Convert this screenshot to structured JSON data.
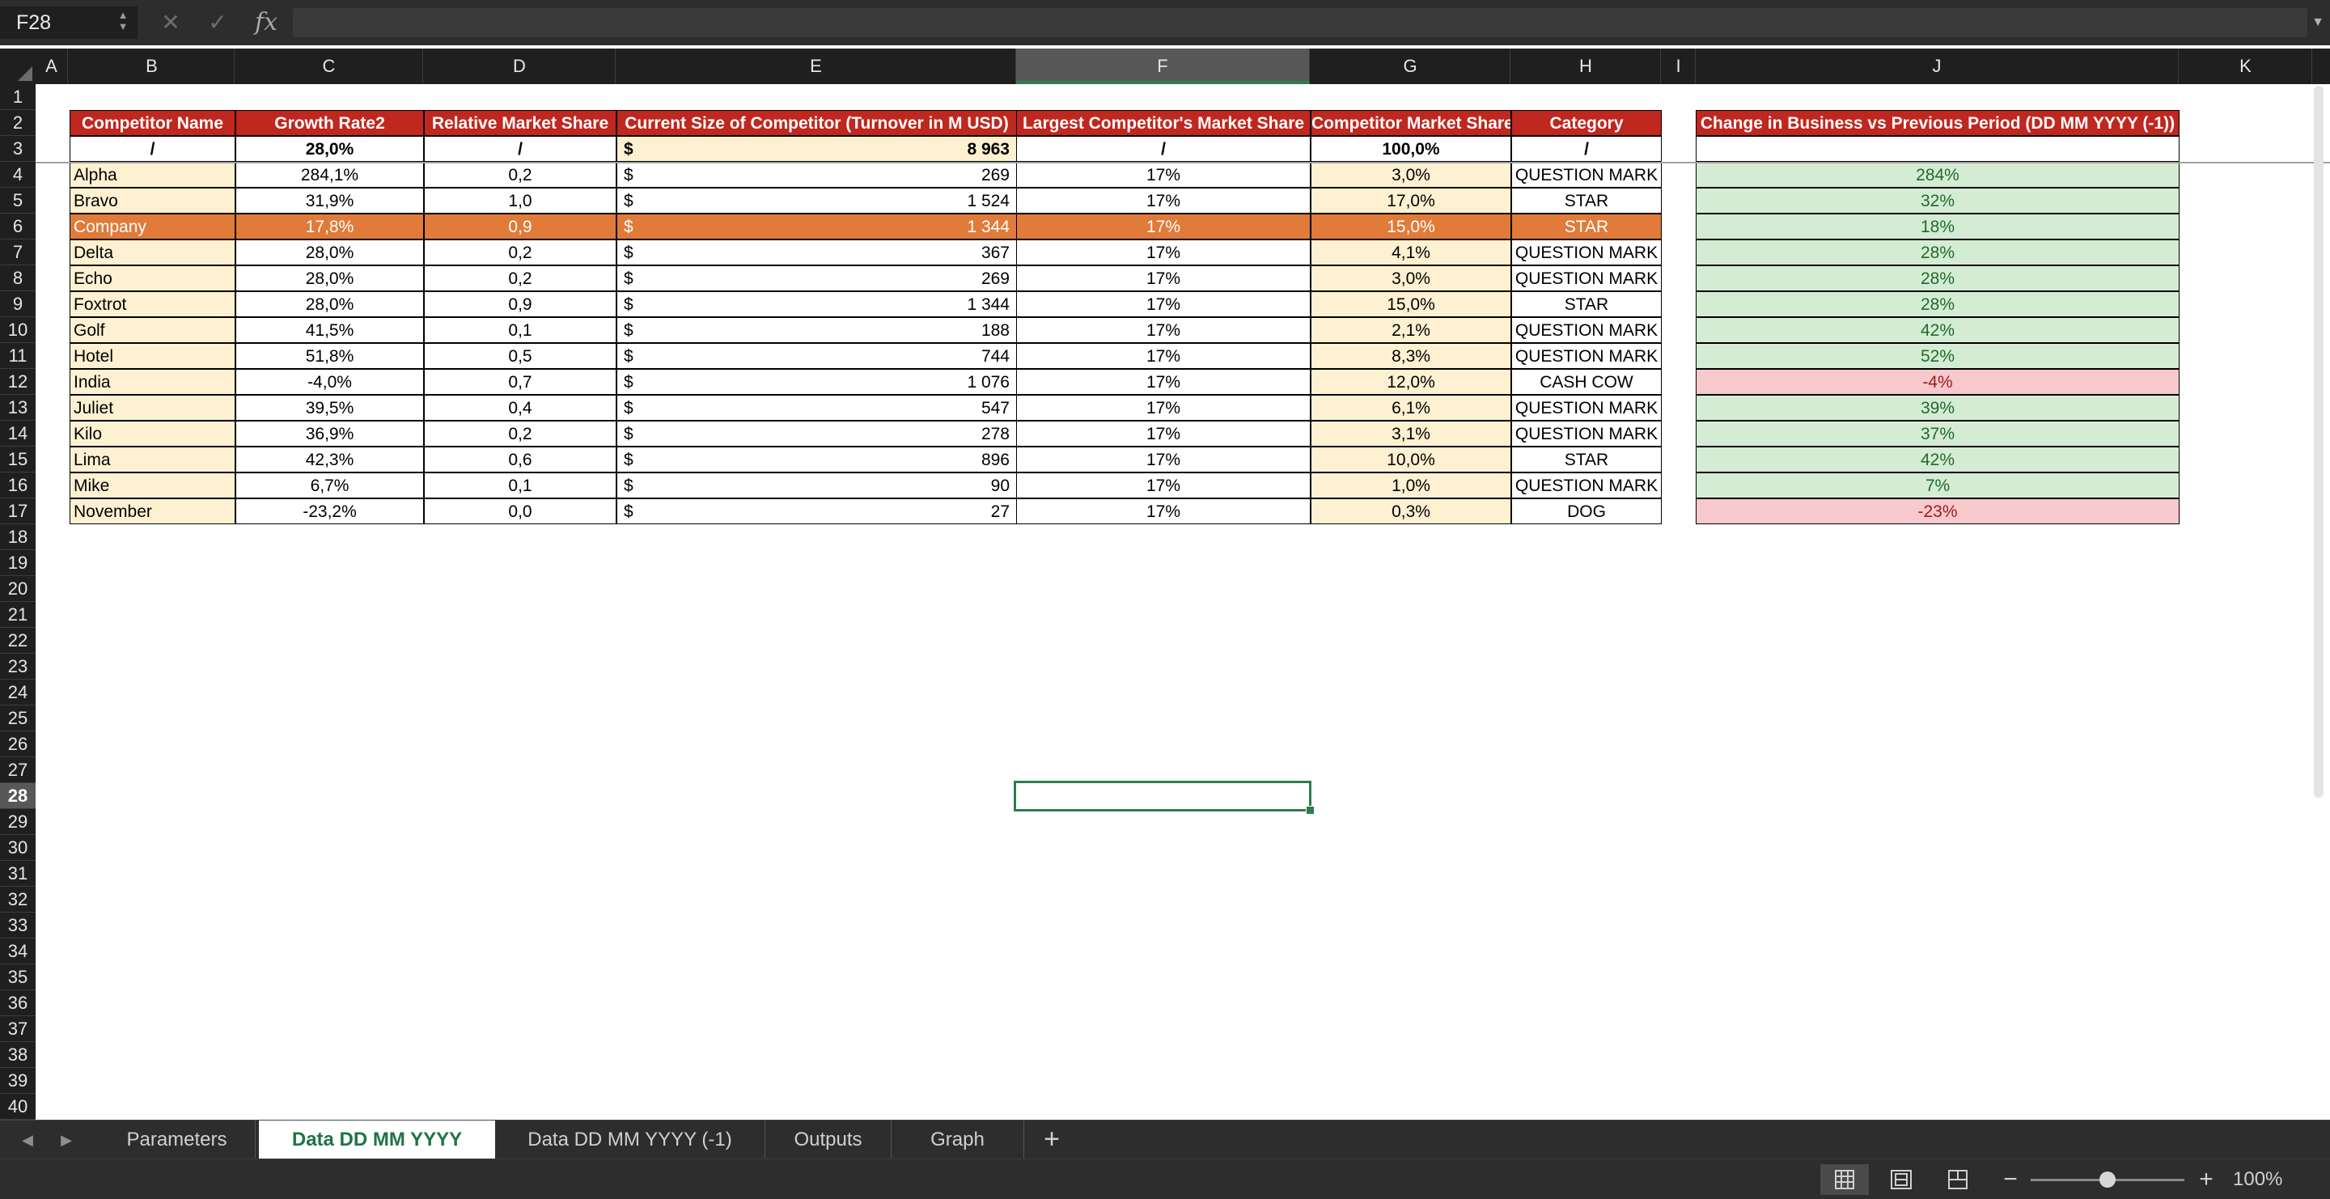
{
  "formula_bar": {
    "name_box": "F28",
    "fx": "fx",
    "formula": ""
  },
  "columns": [
    "A",
    "B",
    "C",
    "D",
    "E",
    "F",
    "G",
    "H",
    "I",
    "J",
    "K"
  ],
  "rows": [
    "1",
    "2",
    "3",
    "4",
    "5",
    "6",
    "7",
    "8",
    "9",
    "10",
    "11",
    "12",
    "13",
    "14",
    "15",
    "16",
    "17",
    "18",
    "19",
    "20",
    "21",
    "22",
    "23",
    "24",
    "25",
    "26",
    "27",
    "28",
    "29",
    "30",
    "31",
    "32",
    "33",
    "34",
    "35",
    "36",
    "37",
    "38",
    "39",
    "40"
  ],
  "selected": {
    "column": "F",
    "row": "28"
  },
  "table": {
    "headers": {
      "name": "Competitor Name",
      "growth": "Growth Rate2",
      "rms": "Relative Market Share",
      "size": "Current Size of Competitor (Turnover in M USD)",
      "largest": "Largest Competitor's Market Share",
      "share": "Competitor Market Share",
      "category": "Category"
    },
    "totals": {
      "name": "/",
      "growth": "28,0%",
      "rms": "/",
      "currency": "$",
      "size": "8 963",
      "largest": "/",
      "share": "100,0%",
      "category": "/"
    },
    "rows": [
      {
        "name": "Alpha",
        "growth": "284,1%",
        "rms": "0,2",
        "currency": "$",
        "size": "269",
        "largest": "17%",
        "share": "3,0%",
        "category": "QUESTION MARK"
      },
      {
        "name": "Bravo",
        "growth": "31,9%",
        "rms": "1,0",
        "currency": "$",
        "size": "1 524",
        "largest": "17%",
        "share": "17,0%",
        "category": "STAR"
      },
      {
        "name": "Company",
        "growth": "17,8%",
        "rms": "0,9",
        "currency": "$",
        "size": "1 344",
        "largest": "17%",
        "share": "15,0%",
        "category": "STAR"
      },
      {
        "name": "Delta",
        "growth": "28,0%",
        "rms": "0,2",
        "currency": "$",
        "size": "367",
        "largest": "17%",
        "share": "4,1%",
        "category": "QUESTION MARK"
      },
      {
        "name": "Echo",
        "growth": "28,0%",
        "rms": "0,2",
        "currency": "$",
        "size": "269",
        "largest": "17%",
        "share": "3,0%",
        "category": "QUESTION MARK"
      },
      {
        "name": "Foxtrot",
        "growth": "28,0%",
        "rms": "0,9",
        "currency": "$",
        "size": "1 344",
        "largest": "17%",
        "share": "15,0%",
        "category": "STAR"
      },
      {
        "name": "Golf",
        "growth": "41,5%",
        "rms": "0,1",
        "currency": "$",
        "size": "188",
        "largest": "17%",
        "share": "2,1%",
        "category": "QUESTION MARK"
      },
      {
        "name": "Hotel",
        "growth": "51,8%",
        "rms": "0,5",
        "currency": "$",
        "size": "744",
        "largest": "17%",
        "share": "8,3%",
        "category": "QUESTION MARK"
      },
      {
        "name": "India",
        "growth": "-4,0%",
        "rms": "0,7",
        "currency": "$",
        "size": "1 076",
        "largest": "17%",
        "share": "12,0%",
        "category": "CASH COW"
      },
      {
        "name": "Juliet",
        "growth": "39,5%",
        "rms": "0,4",
        "currency": "$",
        "size": "547",
        "largest": "17%",
        "share": "6,1%",
        "category": "QUESTION MARK"
      },
      {
        "name": "Kilo",
        "growth": "36,9%",
        "rms": "0,2",
        "currency": "$",
        "size": "278",
        "largest": "17%",
        "share": "3,1%",
        "category": "QUESTION MARK"
      },
      {
        "name": "Lima",
        "growth": "42,3%",
        "rms": "0,6",
        "currency": "$",
        "size": "896",
        "largest": "17%",
        "share": "10,0%",
        "category": "STAR"
      },
      {
        "name": "Mike",
        "growth": "6,7%",
        "rms": "0,1",
        "currency": "$",
        "size": "90",
        "largest": "17%",
        "share": "1,0%",
        "category": "QUESTION MARK"
      },
      {
        "name": "November",
        "growth": "-23,2%",
        "rms": "0,0",
        "currency": "$",
        "size": "27",
        "largest": "17%",
        "share": "0,3%",
        "category": "DOG"
      }
    ]
  },
  "change_table": {
    "header": "Change in Business vs Previous Period (DD MM YYYY (-1))",
    "values": [
      "284%",
      "32%",
      "18%",
      "28%",
      "28%",
      "28%",
      "42%",
      "52%",
      "-4%",
      "39%",
      "37%",
      "42%",
      "7%",
      "-23%"
    ]
  },
  "sheet_tabs": [
    {
      "label": "Parameters",
      "active": false
    },
    {
      "label": "Data DD MM YYYY",
      "active": true
    },
    {
      "label": "Data DD MM YYYY (-1)",
      "active": false
    },
    {
      "label": "Outputs",
      "active": false
    },
    {
      "label": "Graph",
      "active": false
    }
  ],
  "status_bar": {
    "zoom_level": "100%",
    "zoom_fraction": 0.5,
    "views": [
      "normal-view-icon",
      "page-layout-icon",
      "page-break-preview-icon"
    ]
  },
  "colors": {
    "header_red": "#c0271f",
    "highlight_orange": "#e07b39",
    "cream": "#fdf1d2",
    "positive_fill": "#d5ecd4",
    "positive_text": "#1e6b2a",
    "negative_fill": "#f7c9cc",
    "negative_text": "#9c1b22",
    "selection_green": "#2e7d4f"
  }
}
